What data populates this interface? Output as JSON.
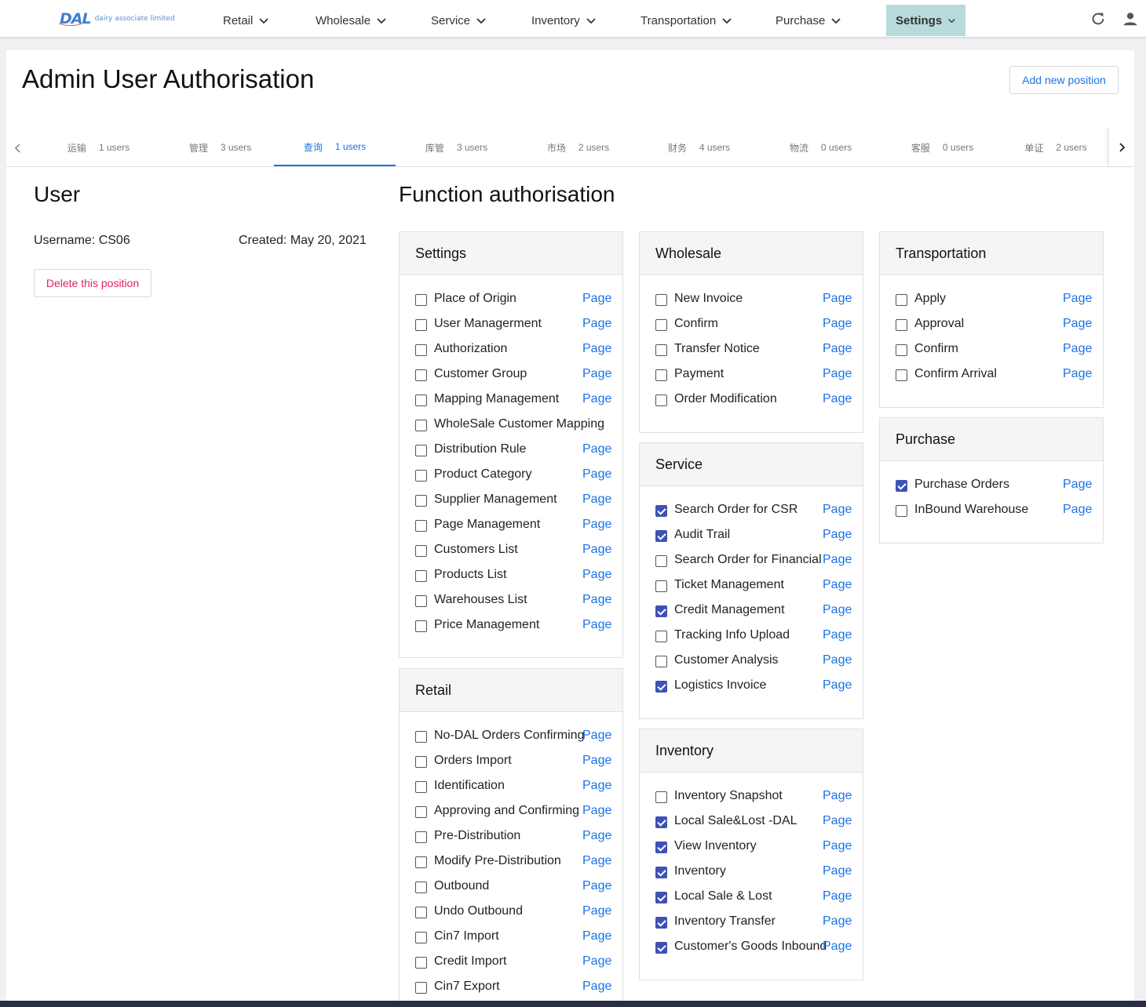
{
  "brand": {
    "mark": "DAL",
    "name": "dairy associate limited"
  },
  "nav": {
    "items": [
      {
        "label": "Retail"
      },
      {
        "label": "Wholesale"
      },
      {
        "label": "Service"
      },
      {
        "label": "Inventory"
      },
      {
        "label": "Transportation"
      },
      {
        "label": "Purchase"
      },
      {
        "label": "Settings",
        "active": true
      }
    ],
    "refresh_icon": "refresh-icon",
    "user_icon": "user-icon"
  },
  "page": {
    "title": "Admin User Authorisation",
    "add_button": "Add new position"
  },
  "tabs": [
    {
      "name": "运输",
      "count": "1 users"
    },
    {
      "name": "管理",
      "count": "3 users"
    },
    {
      "name": "查询",
      "count": "1 users",
      "active": true
    },
    {
      "name": "库管",
      "count": "3 users"
    },
    {
      "name": "市场",
      "count": "2 users"
    },
    {
      "name": "财务",
      "count": "4 users"
    },
    {
      "name": "物流",
      "count": "0 users"
    },
    {
      "name": "客服",
      "count": "0 users"
    },
    {
      "name": "单证",
      "count": "2 users"
    }
  ],
  "user": {
    "heading": "User",
    "username": "Username: CS06",
    "created": "Created: May 20, 2021",
    "delete_button": "Delete this position"
  },
  "functions": {
    "heading": "Function authorisation",
    "link_label": "Page",
    "panels": [
      {
        "title": "Settings",
        "items": [
          {
            "label": "Place of Origin",
            "checked": false,
            "page": true
          },
          {
            "label": "User Managerment",
            "checked": false,
            "page": true
          },
          {
            "label": "Authorization",
            "checked": false,
            "page": true
          },
          {
            "label": "Customer Group",
            "checked": false,
            "page": true
          },
          {
            "label": "Mapping Management",
            "checked": false,
            "page": true
          },
          {
            "label": "WholeSale Customer Mapping",
            "checked": false,
            "page": false
          },
          {
            "label": "Distribution Rule",
            "checked": false,
            "page": true
          },
          {
            "label": "Product Category",
            "checked": false,
            "page": true
          },
          {
            "label": "Supplier Management",
            "checked": false,
            "page": true
          },
          {
            "label": "Page Management",
            "checked": false,
            "page": true
          },
          {
            "label": "Customers List",
            "checked": false,
            "page": true
          },
          {
            "label": "Products List",
            "checked": false,
            "page": true
          },
          {
            "label": "Warehouses List",
            "checked": false,
            "page": true
          },
          {
            "label": "Price Management",
            "checked": false,
            "page": true
          }
        ]
      },
      {
        "title": "Retail",
        "items": [
          {
            "label": "No-DAL Orders Confirming",
            "checked": false,
            "page": true
          },
          {
            "label": "Orders Import",
            "checked": false,
            "page": true
          },
          {
            "label": "Identification",
            "checked": false,
            "page": true
          },
          {
            "label": "Approving and Confirming",
            "checked": false,
            "page": true
          },
          {
            "label": "Pre-Distribution",
            "checked": false,
            "page": true
          },
          {
            "label": "Modify Pre-Distribution",
            "checked": false,
            "page": true
          },
          {
            "label": "Outbound",
            "checked": false,
            "page": true
          },
          {
            "label": "Undo Outbound",
            "checked": false,
            "page": true
          },
          {
            "label": "Cin7 Import",
            "checked": false,
            "page": true
          },
          {
            "label": "Credit Import",
            "checked": false,
            "page": true
          },
          {
            "label": "Cin7 Export",
            "checked": false,
            "page": true
          }
        ]
      },
      {
        "title": "Wholesale",
        "items": [
          {
            "label": "New Invoice",
            "checked": false,
            "page": true
          },
          {
            "label": "Confirm",
            "checked": false,
            "page": true
          },
          {
            "label": "Transfer Notice",
            "checked": false,
            "page": true
          },
          {
            "label": "Payment",
            "checked": false,
            "page": true
          },
          {
            "label": "Order Modification",
            "checked": false,
            "page": true
          }
        ]
      },
      {
        "title": "Service",
        "items": [
          {
            "label": "Search Order for CSR",
            "checked": true,
            "page": true
          },
          {
            "label": "Audit Trail",
            "checked": true,
            "page": true
          },
          {
            "label": "Search Order for Financial",
            "checked": false,
            "page": true
          },
          {
            "label": "Ticket Management",
            "checked": false,
            "page": true
          },
          {
            "label": "Credit Management",
            "checked": true,
            "page": true
          },
          {
            "label": "Tracking Info Upload",
            "checked": false,
            "page": true
          },
          {
            "label": "Customer Analysis",
            "checked": false,
            "page": true
          },
          {
            "label": "Logistics Invoice",
            "checked": true,
            "page": true
          }
        ]
      },
      {
        "title": "Inventory",
        "items": [
          {
            "label": "Inventory Snapshot",
            "checked": false,
            "page": true
          },
          {
            "label": "Local Sale&Lost -DAL",
            "checked": true,
            "page": true
          },
          {
            "label": "View Inventory",
            "checked": true,
            "page": true
          },
          {
            "label": "Inventory",
            "checked": true,
            "page": true
          },
          {
            "label": "Local Sale & Lost",
            "checked": true,
            "page": true
          },
          {
            "label": "Inventory Transfer",
            "checked": true,
            "page": true
          },
          {
            "label": "Customer's Goods Inbound",
            "checked": true,
            "page": true
          }
        ]
      },
      {
        "title": "Transportation",
        "items": [
          {
            "label": "Apply",
            "checked": false,
            "page": true
          },
          {
            "label": "Approval",
            "checked": false,
            "page": true
          },
          {
            "label": "Confirm",
            "checked": false,
            "page": true
          },
          {
            "label": "Confirm Arrival",
            "checked": false,
            "page": true
          }
        ]
      },
      {
        "title": "Purchase",
        "items": [
          {
            "label": "Purchase Orders",
            "checked": true,
            "page": true
          },
          {
            "label": "InBound Warehouse",
            "checked": false,
            "page": true
          }
        ]
      }
    ]
  },
  "colors": {
    "accent": "#1a73e8",
    "check": "#3f51b5",
    "danger": "#e0245e",
    "nav_active": "#b7dbdc"
  }
}
